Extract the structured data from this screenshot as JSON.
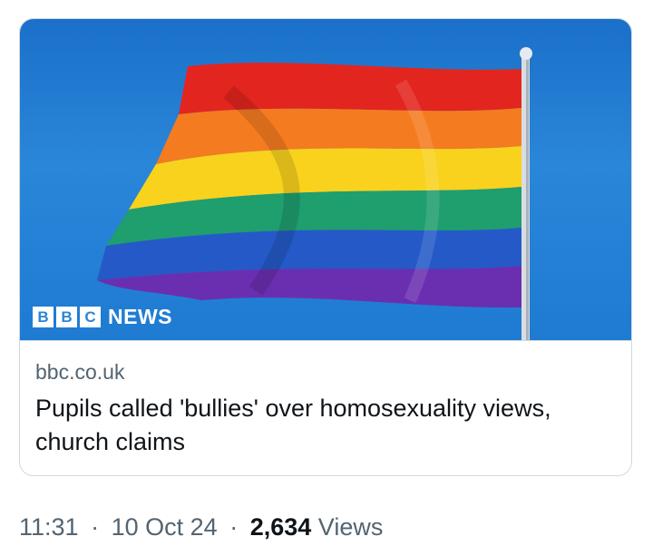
{
  "card": {
    "source_logo": {
      "letters": [
        "B",
        "B",
        "C"
      ],
      "word": "NEWS"
    },
    "domain": "bbc.co.uk",
    "headline": "Pupils called 'bullies' over homosexuality views, church claims"
  },
  "footer": {
    "time": "11:31",
    "separator": "·",
    "date": "10 Oct 24",
    "views_count": "2,634",
    "views_label": "Views"
  },
  "colors": {
    "sky": "#2a86d8",
    "border": "#cfd9de",
    "muted_text": "#536471",
    "primary_text": "#0f1419"
  }
}
